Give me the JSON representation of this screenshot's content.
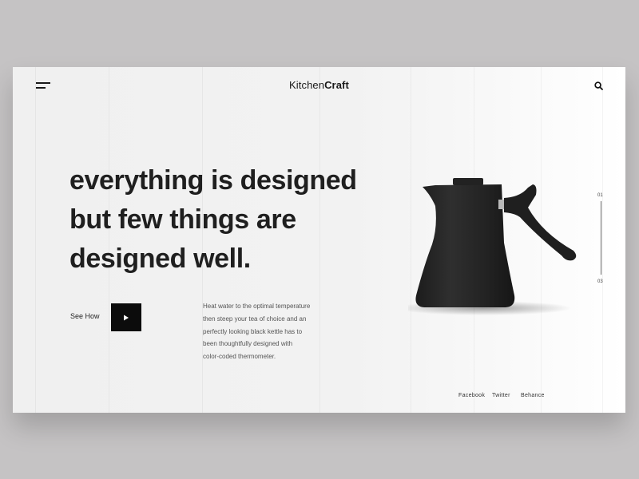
{
  "header": {
    "logo_light": "Kitchen",
    "logo_bold": "Craft",
    "menu_icon": "hamburger-menu-icon",
    "search_icon": "search-icon"
  },
  "hero": {
    "headline_lines": [
      "everything is designed",
      "but few things are",
      "designed well."
    ],
    "cta_label": "See How",
    "play_icon": "play-icon",
    "description_lines": [
      "Heat water to the optimal temperature",
      "then steep your tea of choice and an",
      "perfectly looking black kettle has to",
      "been thoughtfully designed with",
      "color-coded thermometer."
    ]
  },
  "product": {
    "image": "black-pour-over-kettle",
    "color": "#262626"
  },
  "pager": {
    "current": "01",
    "total": "03"
  },
  "social": [
    "Facebook",
    "Twitter",
    "Behance"
  ],
  "colors": {
    "background": "#c5c3c4",
    "card": "#f2f2f2",
    "text": "#1f1f1f",
    "button": "#0c0c0c"
  }
}
